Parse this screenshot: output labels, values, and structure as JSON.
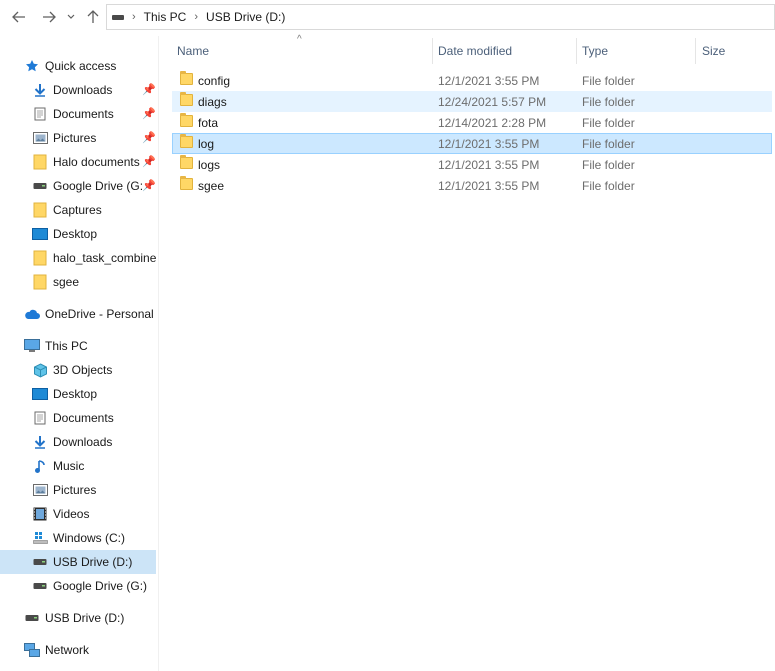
{
  "nav": {
    "path": [
      {
        "label": "This PC"
      },
      {
        "label": "USB Drive (D:)"
      }
    ]
  },
  "sidebar": {
    "quick_access": {
      "label": "Quick access"
    },
    "quick_items": [
      {
        "label": "Downloads",
        "icon": "download-arrow-icon",
        "pinned": true
      },
      {
        "label": "Documents",
        "icon": "document-icon",
        "pinned": true
      },
      {
        "label": "Pictures",
        "icon": "pictures-icon",
        "pinned": true
      },
      {
        "label": "Halo documents",
        "icon": "folder-icon",
        "pinned": true
      },
      {
        "label": "Google Drive (G:",
        "icon": "drive-icon",
        "pinned": true
      },
      {
        "label": "Captures",
        "icon": "folder-icon",
        "pinned": false
      },
      {
        "label": "Desktop",
        "icon": "desktop-icon",
        "pinned": false
      },
      {
        "label": "halo_task_combined",
        "icon": "folder-icon",
        "pinned": false
      },
      {
        "label": "sgee",
        "icon": "folder-icon",
        "pinned": false
      }
    ],
    "onedrive": {
      "label": "OneDrive - Personal"
    },
    "this_pc": {
      "label": "This PC"
    },
    "pc_items": [
      {
        "label": "3D Objects",
        "icon": "3d-objects-icon"
      },
      {
        "label": "Desktop",
        "icon": "desktop-icon"
      },
      {
        "label": "Documents",
        "icon": "document-icon"
      },
      {
        "label": "Downloads",
        "icon": "download-arrow-icon"
      },
      {
        "label": "Music",
        "icon": "music-note-icon"
      },
      {
        "label": "Pictures",
        "icon": "pictures-icon"
      },
      {
        "label": "Videos",
        "icon": "video-icon"
      },
      {
        "label": "Windows (C:)",
        "icon": "windows-drive-icon"
      },
      {
        "label": "USB Drive (D:)",
        "icon": "drive-icon",
        "selected": true
      },
      {
        "label": "Google Drive (G:)",
        "icon": "drive-icon"
      }
    ],
    "usb_root": {
      "label": "USB Drive (D:)"
    },
    "network": {
      "label": "Network"
    }
  },
  "columns": {
    "name": "Name",
    "date": "Date modified",
    "type": "Type",
    "size": "Size"
  },
  "files": [
    {
      "name": "config",
      "date": "12/1/2021 3:55 PM",
      "type": "File folder",
      "state": ""
    },
    {
      "name": "diags",
      "date": "12/24/2021 5:57 PM",
      "type": "File folder",
      "state": "hover"
    },
    {
      "name": "fota",
      "date": "12/14/2021 2:28 PM",
      "type": "File folder",
      "state": ""
    },
    {
      "name": "log",
      "date": "12/1/2021 3:55 PM",
      "type": "File folder",
      "state": "selected"
    },
    {
      "name": "logs",
      "date": "12/1/2021 3:55 PM",
      "type": "File folder",
      "state": ""
    },
    {
      "name": "sgee",
      "date": "12/1/2021 3:55 PM",
      "type": "File folder",
      "state": ""
    }
  ],
  "colors": {
    "accent": "#0078d7",
    "selection": "#cce8ff",
    "folder": "#ffd766"
  }
}
